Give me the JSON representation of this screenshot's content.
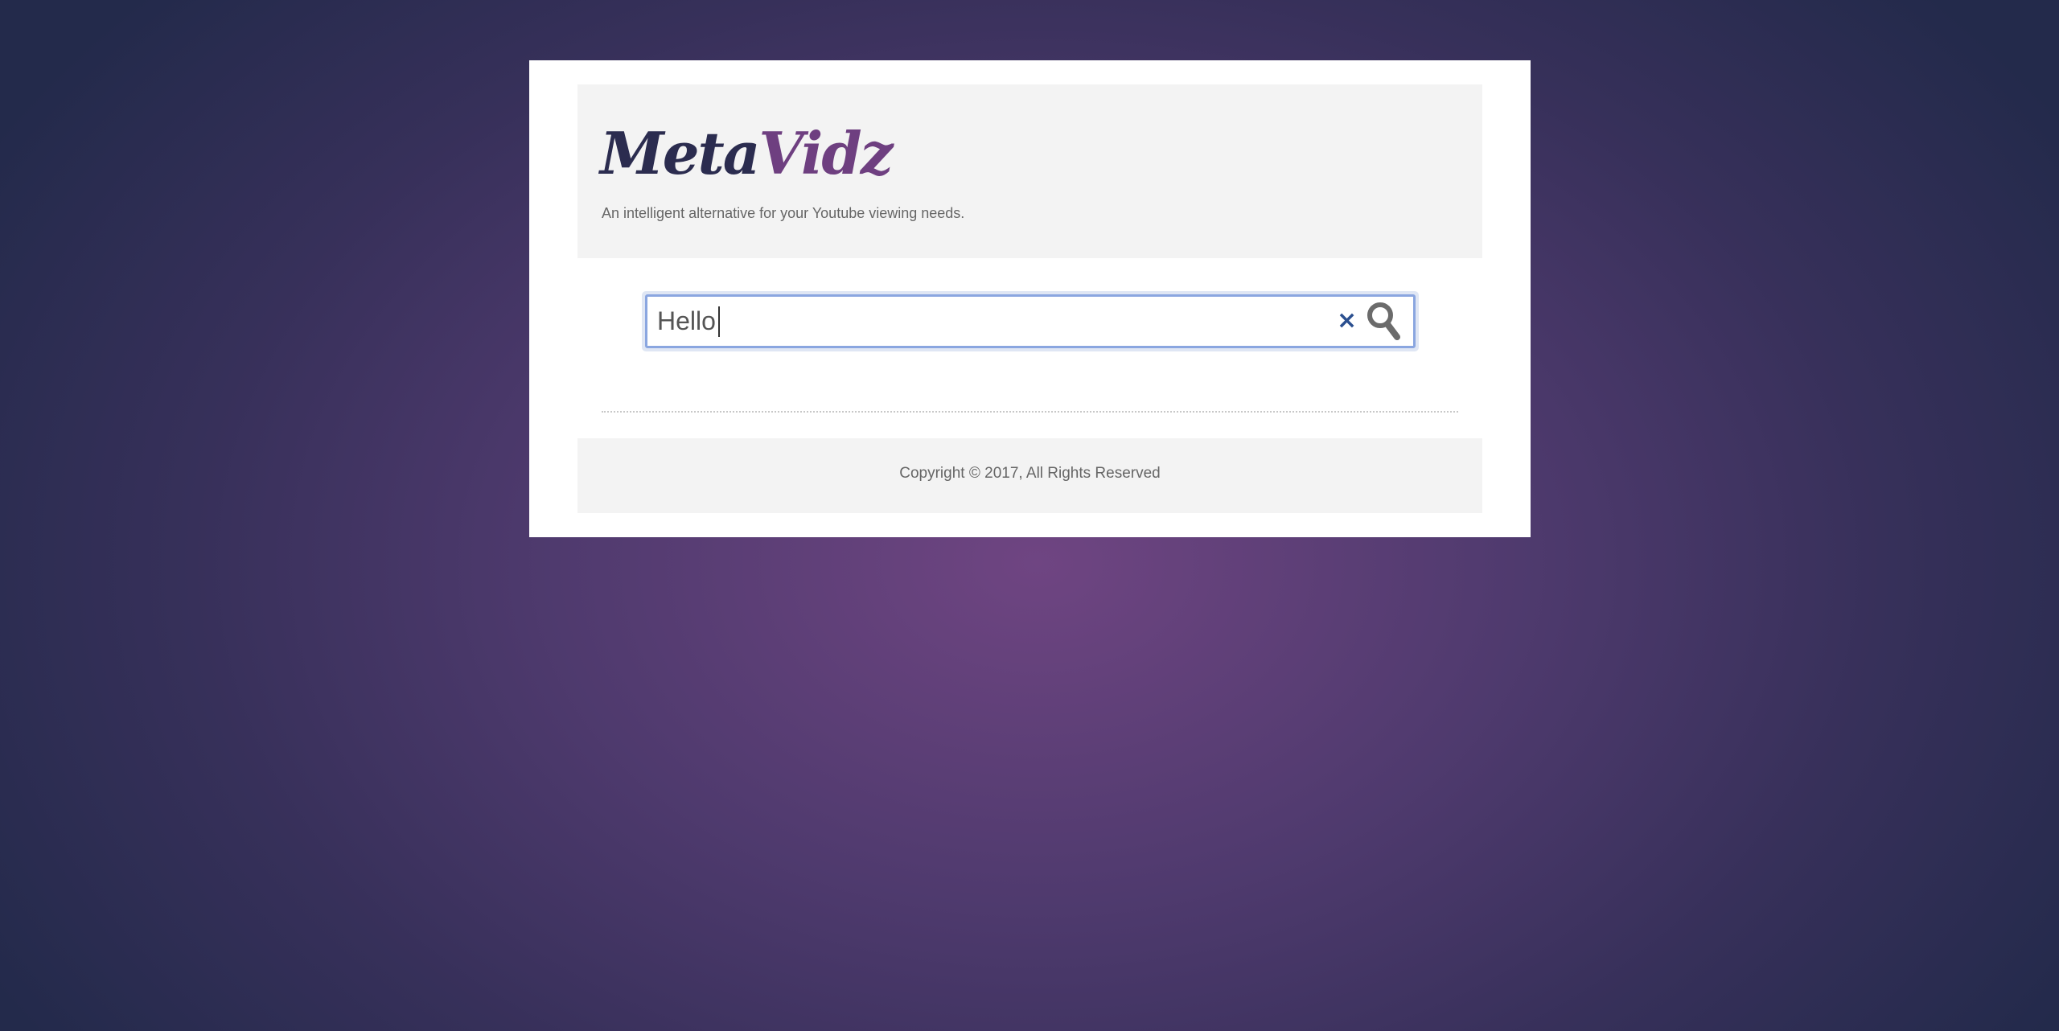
{
  "brand": {
    "logo_part1": "Meta",
    "logo_part2": "Vidz",
    "tagline": "An intelligent alternative for your Youtube viewing needs.",
    "colors": {
      "logo_primary": "#2b2c4f",
      "logo_accent": "#6e3f80",
      "background": "#4f3a6e"
    }
  },
  "search": {
    "value": "Hello",
    "clear_icon": "×",
    "clear_icon_name": "close-icon",
    "search_icon_name": "search-icon"
  },
  "footer": {
    "copyright": "Copyright © 2017, All Rights Reserved"
  }
}
